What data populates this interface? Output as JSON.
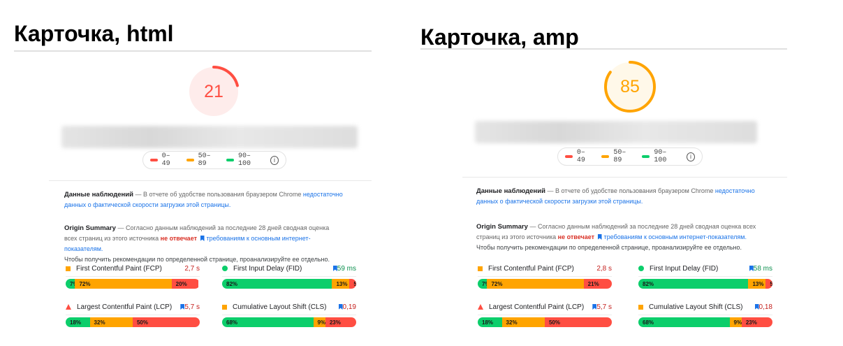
{
  "colors": {
    "poor": "#ff4e42",
    "average": "#ffa400",
    "good": "#0cce6b",
    "link": "#1a73e8"
  },
  "panels": [
    {
      "title": "Карточка, html",
      "score": "21",
      "score_fraction": 0.21,
      "score_color": "#ff4e42",
      "score_bg": "#feeceb",
      "legend": [
        "0–49",
        "50–89",
        "90–100"
      ],
      "field_data": {
        "heading": "Данные наблюдений",
        "text": "— В отчете об удобстве пользования браузером Chrome",
        "link": "недостаточно данных о фактической скорости загрузки этой страницы."
      },
      "origin_summary": {
        "heading": "Origin Summary",
        "text1": "— Согласно данным наблюдений за последние 28 дней сводная оценка всех страниц из этого источника",
        "status": "не отвечает",
        "link": "требованиям к основным интернет-показателям.",
        "text2": "Чтобы получить рекомендации по определенной странице, проанализируйте ее отдельно."
      },
      "metrics": [
        {
          "name": "First Contentful Paint (FCP)",
          "value": "2,7 s",
          "value_color": "#c5221f",
          "icon": "square-icon",
          "shares": [
            7,
            72,
            20
          ],
          "labels": [
            "7%",
            "72%",
            "20%"
          ],
          "flag": false
        },
        {
          "name": "First Input Delay (FID)",
          "value": "59 ms",
          "value_color": "#0d904f",
          "icon": "circle-icon",
          "shares": [
            82,
            13,
            5
          ],
          "labels": [
            "82%",
            "13%",
            "5%"
          ],
          "flag": true
        },
        {
          "name": "Largest Contentful Paint (LCP)",
          "value": "5,7 s",
          "value_color": "#c5221f",
          "icon": "triangle-icon",
          "shares": [
            18,
            32,
            50
          ],
          "labels": [
            "18%",
            "32%",
            "50%"
          ],
          "flag": true
        },
        {
          "name": "Cumulative Layout Shift (CLS)",
          "value": "0,19",
          "value_color": "#c5221f",
          "icon": "square-icon",
          "shares": [
            68,
            9,
            23
          ],
          "labels": [
            "68%",
            "9%",
            "23%"
          ],
          "flag": true
        }
      ]
    },
    {
      "title": "Карточка, amp",
      "score": "85",
      "score_fraction": 0.85,
      "score_color": "#ffa400",
      "score_bg": "#fff8e9",
      "legend": [
        "0–49",
        "50–89",
        "90–100"
      ],
      "field_data": {
        "heading": "Данные наблюдений",
        "text": "— В отчете об удобстве пользования браузером Chrome",
        "link": "недостаточно данных о фактической скорости загрузки этой страницы."
      },
      "origin_summary": {
        "heading": "Origin Summary",
        "text1": "— Согласно данным наблюдений за последние 28 дней сводная оценка всех страниц из этого источника",
        "status": "не отвечает",
        "link": "требованиям к основным интернет-показателям.",
        "text2": "Чтобы получить рекомендации по определенной странице, проанализируйте ее отдельно."
      },
      "metrics": [
        {
          "name": "First Contentful Paint (FCP)",
          "value": "2,8 s",
          "value_color": "#c5221f",
          "icon": "square-icon",
          "shares": [
            7,
            72,
            21
          ],
          "labels": [
            "7%",
            "72%",
            "21%"
          ],
          "flag": false
        },
        {
          "name": "First Input Delay (FID)",
          "value": "58 ms",
          "value_color": "#0d904f",
          "icon": "circle-icon",
          "shares": [
            82,
            13,
            5
          ],
          "labels": [
            "82%",
            "13%",
            "5%"
          ],
          "flag": true
        },
        {
          "name": "Largest Contentful Paint (LCP)",
          "value": "5,7 s",
          "value_color": "#c5221f",
          "icon": "triangle-icon",
          "shares": [
            18,
            32,
            50
          ],
          "labels": [
            "18%",
            "32%",
            "50%"
          ],
          "flag": true
        },
        {
          "name": "Cumulative Layout Shift (CLS)",
          "value": "0,18",
          "value_color": "#c5221f",
          "icon": "square-icon",
          "shares": [
            68,
            9,
            23
          ],
          "labels": [
            "68%",
            "9%",
            "23%"
          ],
          "flag": true
        }
      ]
    }
  ]
}
